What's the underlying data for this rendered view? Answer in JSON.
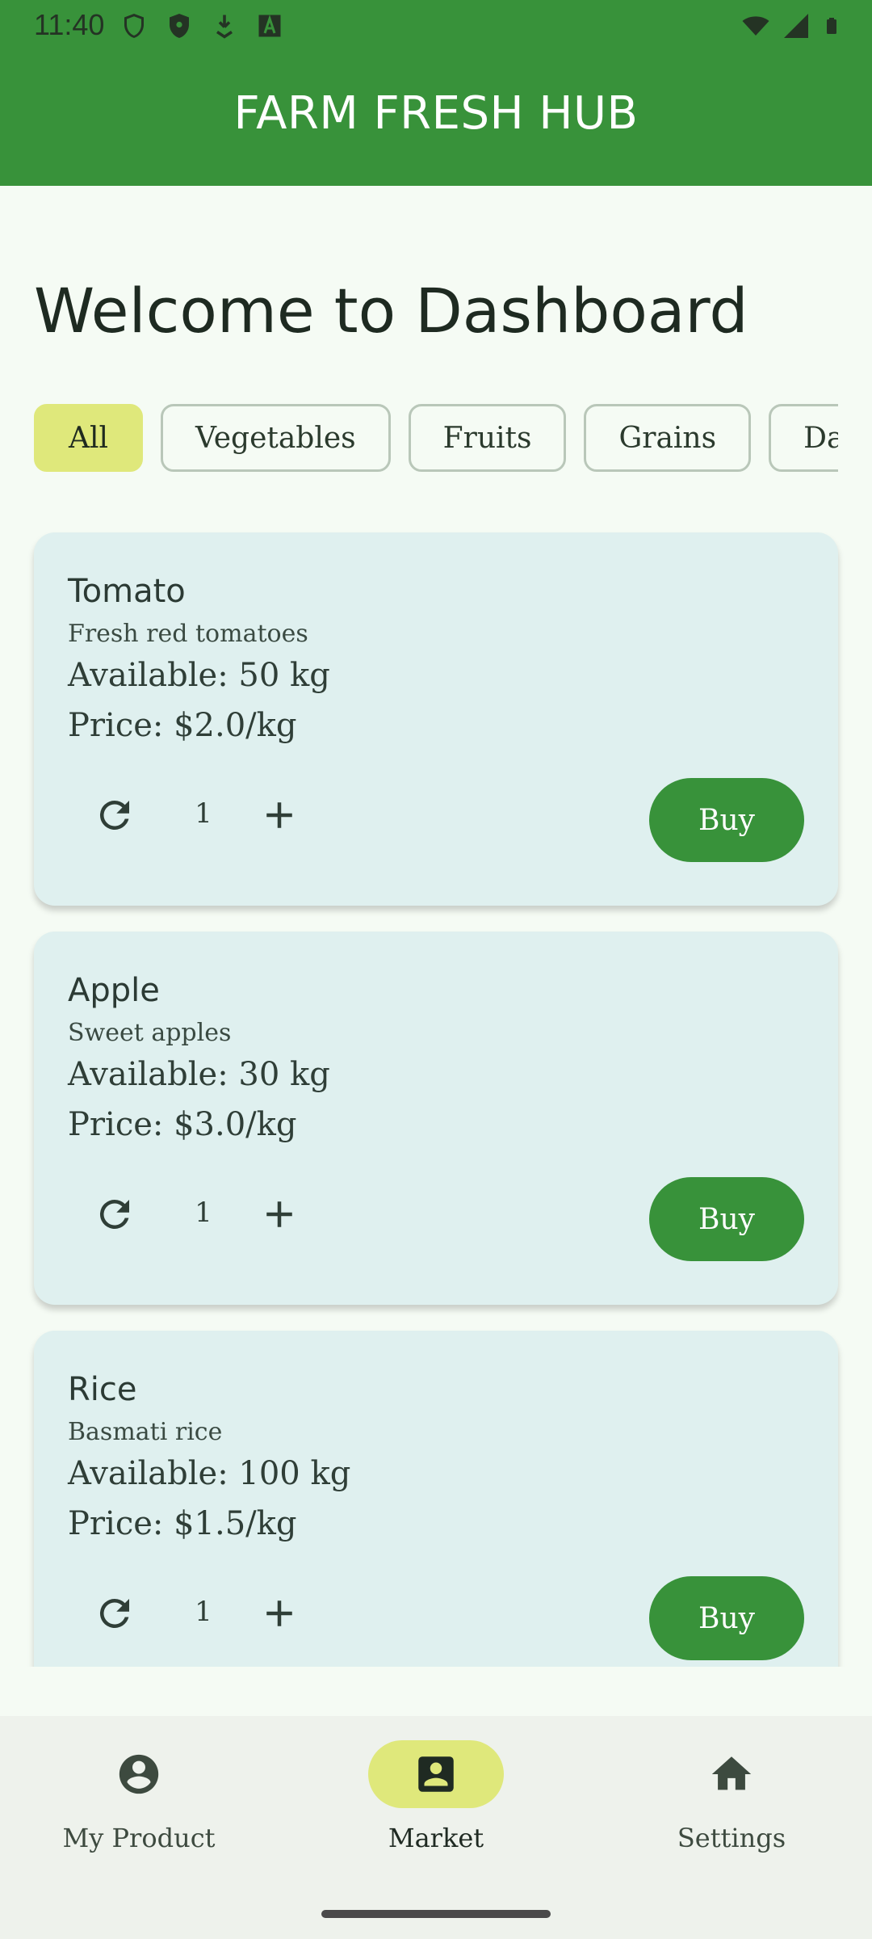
{
  "status_bar": {
    "time": "11:40",
    "left_icons": [
      "shield-outline-icon",
      "shield-filled-icon",
      "download-icon",
      "font-a-icon"
    ],
    "right_icons": [
      "wifi-icon",
      "signal-icon",
      "battery-icon"
    ]
  },
  "app_bar": {
    "title": "FARM FRESH HUB",
    "color": "#38923a"
  },
  "welcome_title": "Welcome to Dashboard",
  "filters": {
    "selected": "All",
    "chips": [
      {
        "label": "All"
      },
      {
        "label": "Vegetables"
      },
      {
        "label": "Fruits"
      },
      {
        "label": "Grains"
      },
      {
        "label": "Dairy"
      }
    ]
  },
  "products": [
    {
      "name": "Tomato",
      "description": "Fresh red tomatoes",
      "available": "Available: 50 kg",
      "price": "Price: $2.0/kg",
      "quantity": "1",
      "buy_label": "Buy"
    },
    {
      "name": "Apple",
      "description": "Sweet apples",
      "available": "Available: 30 kg",
      "price": "Price: $3.0/kg",
      "quantity": "1",
      "buy_label": "Buy"
    },
    {
      "name": "Rice",
      "description": "Basmati rice",
      "available": "Available: 100 kg",
      "price": "Price: $1.5/kg",
      "quantity": "1",
      "buy_label": "Buy"
    }
  ],
  "bottom_nav": {
    "active": "Market",
    "items": [
      {
        "label": "My Product",
        "icon": "account-circle-icon"
      },
      {
        "label": "Market",
        "icon": "person-card-icon"
      },
      {
        "label": "Settings",
        "icon": "home-icon"
      }
    ]
  },
  "colors": {
    "primary": "#38923a",
    "chip_selected": "#dfe87b",
    "card_background": "#dff0ef",
    "page_background": "#f5fbf4",
    "nav_background": "#eef2ec"
  }
}
